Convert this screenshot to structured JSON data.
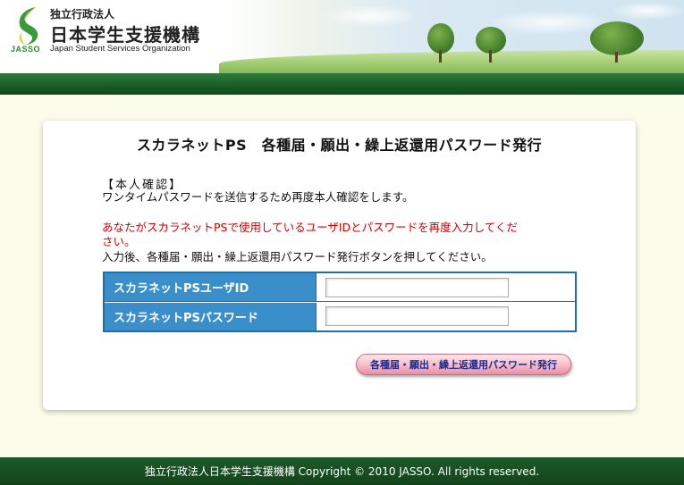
{
  "header": {
    "org_small": "独立行政法人",
    "org_name": "日本学生支援機構",
    "org_english": "Japan Student Services Organization",
    "logo_text": "JASSO"
  },
  "colors": {
    "brand_green": "#1c5e29",
    "form_label_blue": "#3a8fcb",
    "form_border_blue": "#1e6fa8",
    "warning_red": "#d40000",
    "button_pink": "#f7b5c4"
  },
  "main": {
    "title": "スカラネットPS　各種届・願出・繰上返還用パスワード発行",
    "section_heading": "【本人確認】",
    "intro": "ワンタイムパスワードを送信するため再度本人確認をします。",
    "warning_line1": "あなたがスカラネットPSで使用しているユーザIDとパスワードを再度入力してくだ",
    "warning_line2": "さい。",
    "instruction": "入力後、各種届・願出・繰上返還用パスワード発行ボタンを押してください。"
  },
  "form": {
    "user_id_label": "スカラネットPSユーザID",
    "user_id_value": "",
    "password_label": "スカラネットPSパスワード",
    "password_value": ""
  },
  "actions": {
    "issue_button": "各種届・願出・繰上返還用パスワード発行"
  },
  "footer": {
    "copyright": "独立行政法人日本学生支援機構 Copyright © 2010 JASSO. All rights reserved."
  }
}
